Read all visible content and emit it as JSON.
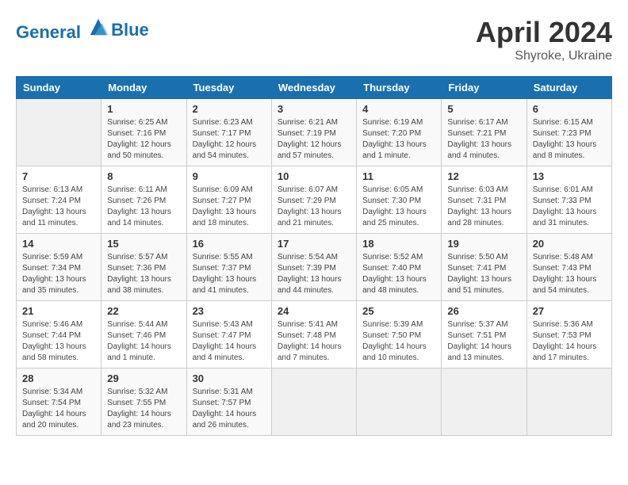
{
  "header": {
    "logo_line1": "General",
    "logo_line2": "Blue",
    "month": "April 2024",
    "location": "Shyroke, Ukraine"
  },
  "weekdays": [
    "Sunday",
    "Monday",
    "Tuesday",
    "Wednesday",
    "Thursday",
    "Friday",
    "Saturday"
  ],
  "weeks": [
    [
      {
        "day": "",
        "info": ""
      },
      {
        "day": "1",
        "info": "Sunrise: 6:25 AM\nSunset: 7:16 PM\nDaylight: 12 hours\nand 50 minutes."
      },
      {
        "day": "2",
        "info": "Sunrise: 6:23 AM\nSunset: 7:17 PM\nDaylight: 12 hours\nand 54 minutes."
      },
      {
        "day": "3",
        "info": "Sunrise: 6:21 AM\nSunset: 7:19 PM\nDaylight: 12 hours\nand 57 minutes."
      },
      {
        "day": "4",
        "info": "Sunrise: 6:19 AM\nSunset: 7:20 PM\nDaylight: 13 hours\nand 1 minute."
      },
      {
        "day": "5",
        "info": "Sunrise: 6:17 AM\nSunset: 7:21 PM\nDaylight: 13 hours\nand 4 minutes."
      },
      {
        "day": "6",
        "info": "Sunrise: 6:15 AM\nSunset: 7:23 PM\nDaylight: 13 hours\nand 8 minutes."
      }
    ],
    [
      {
        "day": "7",
        "info": "Sunrise: 6:13 AM\nSunset: 7:24 PM\nDaylight: 13 hours\nand 11 minutes."
      },
      {
        "day": "8",
        "info": "Sunrise: 6:11 AM\nSunset: 7:26 PM\nDaylight: 13 hours\nand 14 minutes."
      },
      {
        "day": "9",
        "info": "Sunrise: 6:09 AM\nSunset: 7:27 PM\nDaylight: 13 hours\nand 18 minutes."
      },
      {
        "day": "10",
        "info": "Sunrise: 6:07 AM\nSunset: 7:29 PM\nDaylight: 13 hours\nand 21 minutes."
      },
      {
        "day": "11",
        "info": "Sunrise: 6:05 AM\nSunset: 7:30 PM\nDaylight: 13 hours\nand 25 minutes."
      },
      {
        "day": "12",
        "info": "Sunrise: 6:03 AM\nSunset: 7:31 PM\nDaylight: 13 hours\nand 28 minutes."
      },
      {
        "day": "13",
        "info": "Sunrise: 6:01 AM\nSunset: 7:33 PM\nDaylight: 13 hours\nand 31 minutes."
      }
    ],
    [
      {
        "day": "14",
        "info": "Sunrise: 5:59 AM\nSunset: 7:34 PM\nDaylight: 13 hours\nand 35 minutes."
      },
      {
        "day": "15",
        "info": "Sunrise: 5:57 AM\nSunset: 7:36 PM\nDaylight: 13 hours\nand 38 minutes."
      },
      {
        "day": "16",
        "info": "Sunrise: 5:55 AM\nSunset: 7:37 PM\nDaylight: 13 hours\nand 41 minutes."
      },
      {
        "day": "17",
        "info": "Sunrise: 5:54 AM\nSunset: 7:39 PM\nDaylight: 13 hours\nand 44 minutes."
      },
      {
        "day": "18",
        "info": "Sunrise: 5:52 AM\nSunset: 7:40 PM\nDaylight: 13 hours\nand 48 minutes."
      },
      {
        "day": "19",
        "info": "Sunrise: 5:50 AM\nSunset: 7:41 PM\nDaylight: 13 hours\nand 51 minutes."
      },
      {
        "day": "20",
        "info": "Sunrise: 5:48 AM\nSunset: 7:43 PM\nDaylight: 13 hours\nand 54 minutes."
      }
    ],
    [
      {
        "day": "21",
        "info": "Sunrise: 5:46 AM\nSunset: 7:44 PM\nDaylight: 13 hours\nand 58 minutes."
      },
      {
        "day": "22",
        "info": "Sunrise: 5:44 AM\nSunset: 7:46 PM\nDaylight: 14 hours\nand 1 minute."
      },
      {
        "day": "23",
        "info": "Sunrise: 5:43 AM\nSunset: 7:47 PM\nDaylight: 14 hours\nand 4 minutes."
      },
      {
        "day": "24",
        "info": "Sunrise: 5:41 AM\nSunset: 7:48 PM\nDaylight: 14 hours\nand 7 minutes."
      },
      {
        "day": "25",
        "info": "Sunrise: 5:39 AM\nSunset: 7:50 PM\nDaylight: 14 hours\nand 10 minutes."
      },
      {
        "day": "26",
        "info": "Sunrise: 5:37 AM\nSunset: 7:51 PM\nDaylight: 14 hours\nand 13 minutes."
      },
      {
        "day": "27",
        "info": "Sunrise: 5:36 AM\nSunset: 7:53 PM\nDaylight: 14 hours\nand 17 minutes."
      }
    ],
    [
      {
        "day": "28",
        "info": "Sunrise: 5:34 AM\nSunset: 7:54 PM\nDaylight: 14 hours\nand 20 minutes."
      },
      {
        "day": "29",
        "info": "Sunrise: 5:32 AM\nSunset: 7:55 PM\nDaylight: 14 hours\nand 23 minutes."
      },
      {
        "day": "30",
        "info": "Sunrise: 5:31 AM\nSunset: 7:57 PM\nDaylight: 14 hours\nand 26 minutes."
      },
      {
        "day": "",
        "info": ""
      },
      {
        "day": "",
        "info": ""
      },
      {
        "day": "",
        "info": ""
      },
      {
        "day": "",
        "info": ""
      }
    ]
  ]
}
